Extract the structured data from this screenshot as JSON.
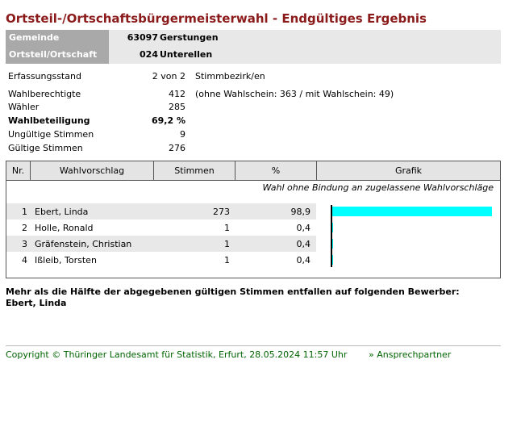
{
  "title": "Ortsteil-/Ortschaftsbürgermeisterwahl - Endgültiges Ergebnis",
  "header": {
    "gemeinde_label": "Gemeinde",
    "gemeinde_code": "63097",
    "gemeinde_name": "Gerstungen",
    "ortsteil_label": "Ortsteil/Ortschaft",
    "ortsteil_code": "024",
    "ortsteil_name": "Unterellen"
  },
  "info": {
    "erfassung": {
      "label": "Erfassungsstand",
      "value": "2 von 2",
      "extra": "Stimmbezirk/en"
    },
    "berechtigte": {
      "label": "Wahlberechtigte",
      "value": "412",
      "extra": "(ohne Wahlschein: 363 / mit Wahlschein: 49)"
    },
    "waehler": {
      "label": "Wähler",
      "value": "285"
    },
    "beteiligung": {
      "label": "Wahlbeteiligung",
      "value": "69,2 %"
    },
    "ungueltig": {
      "label": "Ungültige Stimmen",
      "value": "9"
    },
    "gueltig": {
      "label": "Gültige Stimmen",
      "value": "276"
    }
  },
  "table": {
    "headers": {
      "nr": "Nr.",
      "vorschlag": "Wahlvorschlag",
      "stimmen": "Stimmen",
      "prozent": "%",
      "grafik": "Grafik"
    },
    "note": "Wahl ohne Bindung an zugelassene Wahlvorschläge",
    "bar_color": "#00ffff"
  },
  "chart_data": {
    "type": "bar",
    "categories": [
      "Ebert, Linda",
      "Holle, Ronald",
      "Gräfenstein, Christian",
      "Ißleib, Torsten"
    ],
    "values": [
      98.9,
      0.4,
      0.4,
      0.4
    ],
    "ylim": [
      0,
      100
    ],
    "rows": [
      {
        "nr": "1",
        "name": "Ebert, Linda",
        "stimmen": "273",
        "prozent": "98,9",
        "value": 98.9
      },
      {
        "nr": "2",
        "name": "Holle, Ronald",
        "stimmen": "1",
        "prozent": "0,4",
        "value": 0.4
      },
      {
        "nr": "3",
        "name": "Gräfenstein, Christian",
        "stimmen": "1",
        "prozent": "0,4",
        "value": 0.4
      },
      {
        "nr": "4",
        "name": "Ißleib, Torsten",
        "stimmen": "1",
        "prozent": "0,4",
        "value": 0.4
      }
    ]
  },
  "majority": {
    "text": "Mehr als die Hälfte der abgegebenen gültigen Stimmen entfallen auf folgenden Bewerber:",
    "winner": "Ebert, Linda"
  },
  "footer": {
    "copyright": "Copyright © Thüringer Landesamt für Statistik, Erfurt, 28.05.2024 11:57 Uhr",
    "contact": "» Ansprechpartner"
  }
}
